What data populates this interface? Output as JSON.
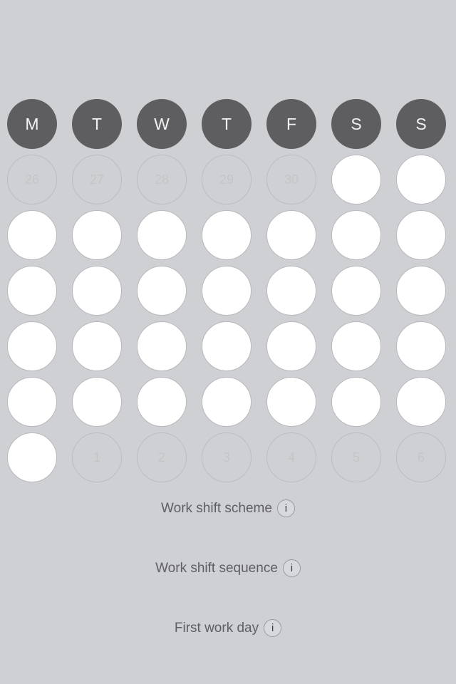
{
  "weekdays": [
    "M",
    "T",
    "W",
    "T",
    "F",
    "S",
    "S"
  ],
  "prev_month_days": [
    "26",
    "27",
    "28",
    "29",
    "30"
  ],
  "next_month_days": [
    "1",
    "2",
    "3",
    "4",
    "5",
    "6"
  ],
  "settings": {
    "work_shift_scheme": "Work shift scheme",
    "work_shift_sequence": "Work shift sequence",
    "first_work_day": "First work day",
    "info_glyph": "i"
  }
}
